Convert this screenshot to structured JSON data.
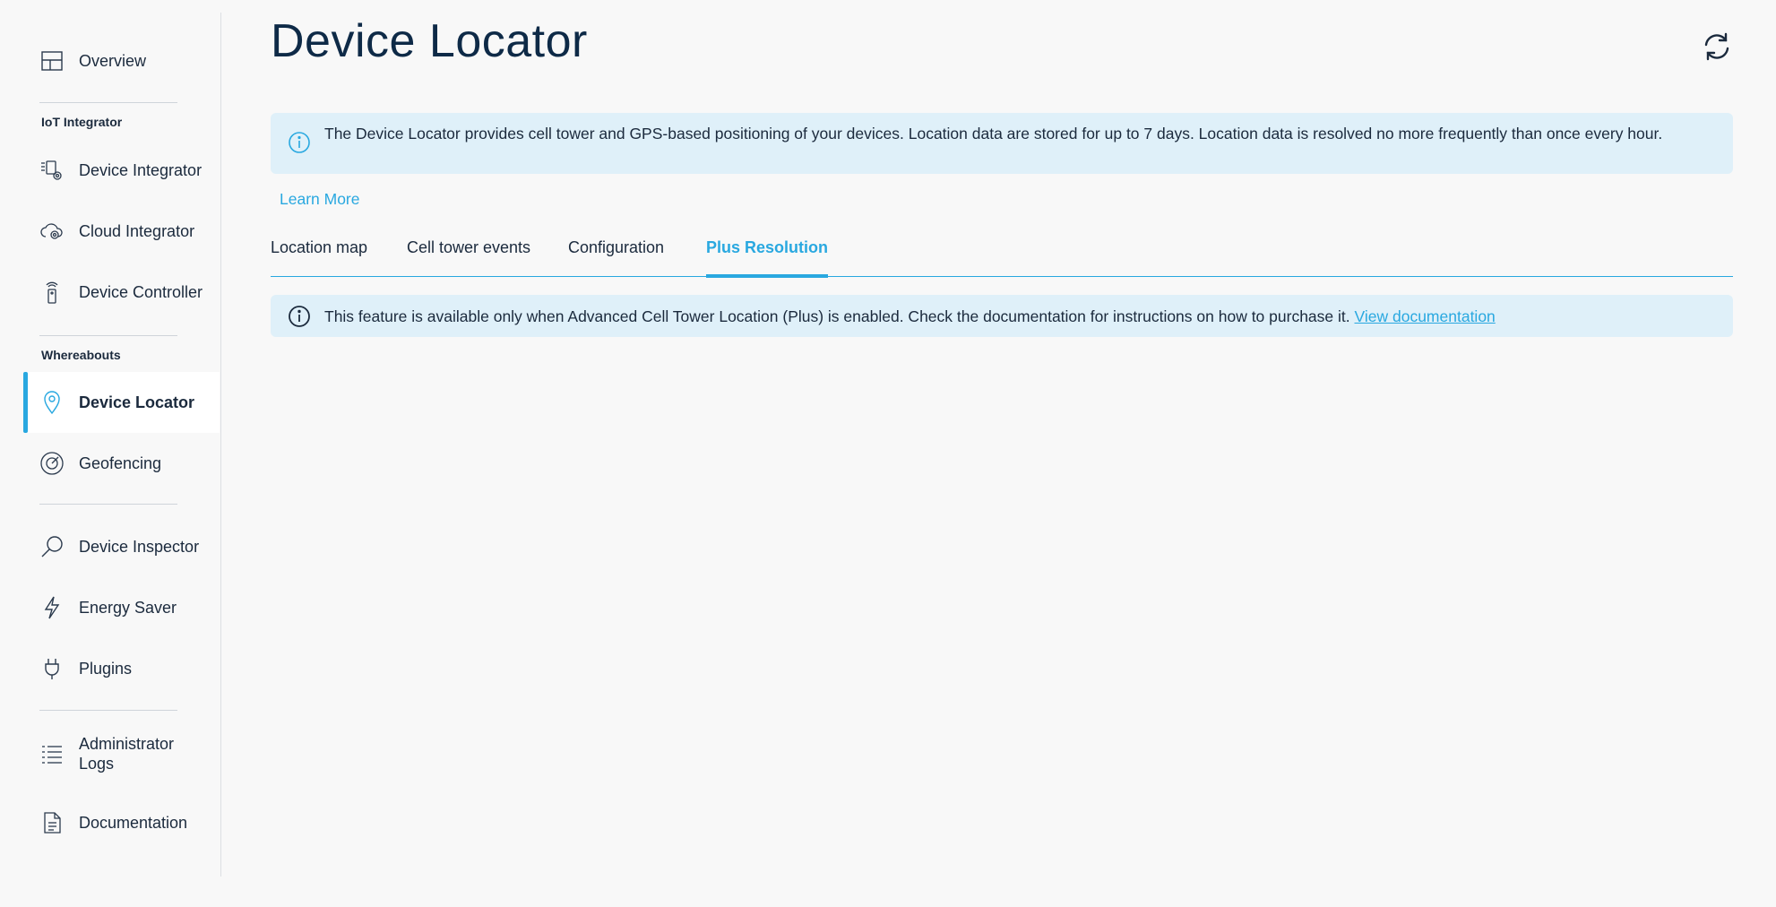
{
  "sidebar": {
    "overview": {
      "label": "Overview",
      "icon": "layout-icon"
    },
    "section_iot": "IoT Integrator",
    "device_integrator": {
      "label": "Device Integrator",
      "icon": "device-gear-icon"
    },
    "cloud_integrator": {
      "label": "Cloud Integrator",
      "icon": "cloud-gear-icon"
    },
    "device_controller": {
      "label": "Device Controller",
      "icon": "remote-control-icon"
    },
    "section_whereabouts": "Whereabouts",
    "device_locator": {
      "label": "Device Locator",
      "icon": "map-pin-icon",
      "active": true
    },
    "geofencing": {
      "label": "Geofencing",
      "icon": "radar-icon"
    },
    "device_inspector": {
      "label": "Device Inspector",
      "icon": "magnifier-icon"
    },
    "energy_saver": {
      "label": "Energy Saver",
      "icon": "lightning-icon"
    },
    "plugins": {
      "label": "Plugins",
      "icon": "plug-icon"
    },
    "admin_logs": {
      "label": "Administrator Logs",
      "icon": "list-icon"
    },
    "documentation": {
      "label": "Documentation",
      "icon": "document-icon"
    }
  },
  "main": {
    "title": "Device Locator",
    "info_banner": "The Device Locator provides cell tower and GPS-based positioning of your devices. Location data are stored for up to 7 days. Location data is resolved no more frequently than once every hour.",
    "learn_more": "Learn More",
    "tabs": [
      {
        "label": "Location map"
      },
      {
        "label": "Cell tower events"
      },
      {
        "label": "Configuration"
      },
      {
        "label": "Plus Resolution",
        "active": true
      }
    ],
    "feature_banner": {
      "text": "This feature is available only when Advanced Cell Tower Location (Plus) is enabled. Check the documentation for instructions on how to purchase it.",
      "link": "View documentation"
    }
  },
  "colors": {
    "accent": "#29a8e0",
    "text": "#1b2a3d",
    "banner_bg": "#dff0f9"
  }
}
